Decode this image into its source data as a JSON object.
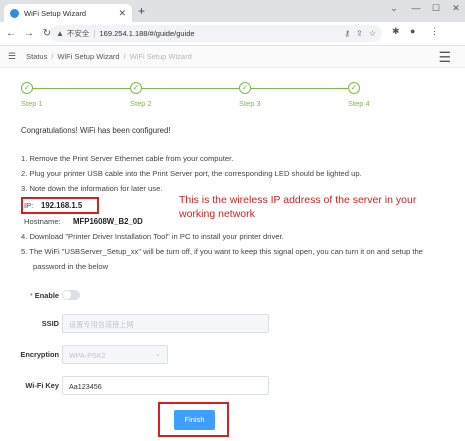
{
  "browser": {
    "tab_title": "WiFi Setup Wizard",
    "insecure_label": "不安全",
    "url": "169.254.1.188/#/guide/guide"
  },
  "header": {
    "breadcrumb": [
      "Status",
      "WiFi Setup Wizard",
      "WiFi Setup Wizard"
    ]
  },
  "steps": [
    {
      "label": "Step 1",
      "status": "done"
    },
    {
      "label": "Step 2",
      "status": "done"
    },
    {
      "label": "Step 3",
      "status": "done"
    },
    {
      "label": "Step 4",
      "status": "done"
    }
  ],
  "content": {
    "congrats": "Congratulations! WiFi has been configured!",
    "inst1": "1. Remove the Print Server Ethernet cable from your computer.",
    "inst2": "2. Plug your printer USB cable into the Print Server port, the corresponding LED should be lighted up.",
    "inst3": "3. Note down the information for later use.",
    "ip_label": "IP:",
    "ip_value": "192.168.1.5",
    "hostname_label": "Hostname:",
    "hostname_value": "MFP1608W_B2_0D",
    "inst4": "4. Download \"Printer Driver Installation Tool\" in PC to install your printer driver.",
    "inst5a": "5. The WiFi \"USBServer_Setup_xx\" will be turn off, if you want to keep this signal open, you can turn it on and setup the",
    "inst5b": "password in the below",
    "annotation": "This is the wireless IP address of the server in your working network"
  },
  "form": {
    "enable_label": "Enable",
    "enable_on": false,
    "ssid_label": "SSID",
    "ssid_placeholder": "设置专用信道接上网",
    "encryption_label": "Encryption",
    "encryption_value": "WPA-PSK2",
    "wifikey_label": "Wi-Fi Key",
    "wifikey_value": "Aa123456",
    "finish_label": "Finish"
  },
  "colors": {
    "accent_green": "#7bbd48",
    "button_blue": "#409eff",
    "annotation_red": "#d61f1f"
  }
}
